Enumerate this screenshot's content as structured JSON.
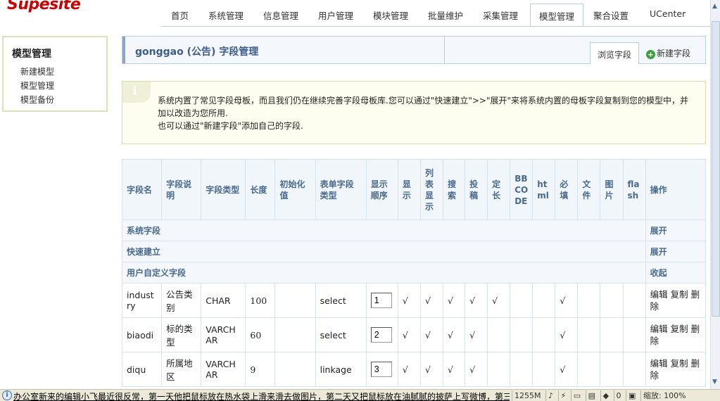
{
  "brand": {
    "logo": "Supesite"
  },
  "nav": {
    "items": [
      "首页",
      "系统管理",
      "信息管理",
      "用户管理",
      "模块管理",
      "批量维护",
      "采集管理",
      "模型管理",
      "聚合设置",
      "UCenter"
    ],
    "active": "模型管理"
  },
  "sidebar": {
    "title": "模型管理",
    "links": [
      "新建模型",
      "模型管理",
      "模型备份"
    ]
  },
  "header": {
    "title": "gonggao (公告) 字段管理",
    "tab_browse": "浏览字段",
    "new_field": "新建字段"
  },
  "notice": {
    "line1": "系统内置了常见字段母板，而且我们仍在继续完善字段母板库.您可以通过\"快速建立\">>\"展开\"来将系统内置的母板字段复制到您的模型中，并加以改造为您所用.",
    "line2": "也可以通过\"新建字段\"添加自己的字段."
  },
  "table": {
    "headers": [
      "字段名",
      "字段说明",
      "字段类型",
      "长度",
      "初始化值",
      "表单字段类型",
      "显示顺序",
      "显示",
      "列表显示",
      "搜索",
      "投稿",
      "定长",
      "BBCODE",
      "html",
      "必填",
      "文件",
      "图片",
      "flash",
      "操作"
    ],
    "sections": {
      "system": {
        "label": "系统字段",
        "action": "展开"
      },
      "quick": {
        "label": "快速建立",
        "action": "展开"
      },
      "custom": {
        "label": "用户自定义字段",
        "action": "收起"
      }
    },
    "rows": [
      {
        "name": "industry",
        "desc": "公告类别",
        "type": "CHAR",
        "length": "100",
        "init": "",
        "form_type": "select",
        "order": "1",
        "checks": [
          "√",
          "√",
          "√",
          "√",
          "√",
          "",
          "",
          "√",
          "",
          "",
          ""
        ],
        "ops": {
          "edit": "编辑",
          "copy": "复制",
          "delete": "删除"
        }
      },
      {
        "name": "biaodi",
        "desc": "标的类型",
        "type": "VARCHAR",
        "length": "60",
        "init": "",
        "form_type": "select",
        "order": "2",
        "checks": [
          "√",
          "√",
          "√",
          "√",
          "",
          "",
          "",
          "√",
          "",
          "",
          ""
        ],
        "ops": {
          "edit": "编辑",
          "copy": "复制",
          "delete": "删除"
        }
      },
      {
        "name": "diqu",
        "desc": "所属地区",
        "type": "VARCHAR",
        "length": "9",
        "init": "",
        "form_type": "linkage",
        "order": "3",
        "checks": [
          "√",
          "√",
          "√",
          "√",
          "",
          "",
          "",
          "√",
          "",
          "",
          ""
        ],
        "ops": {
          "edit": "编辑",
          "copy": "复制",
          "delete": "删除"
        }
      }
    ]
  },
  "statusbar": {
    "text": "办公室新来的编辑小飞最近很反常，第一天他把鼠标放在热水袋上滑来滑去做图片，第二天又把鼠标放在油腻腻的披萨上写微博，第三",
    "memory": "1255M",
    "zoom": "缩放: 100%",
    "counter": "0"
  }
}
